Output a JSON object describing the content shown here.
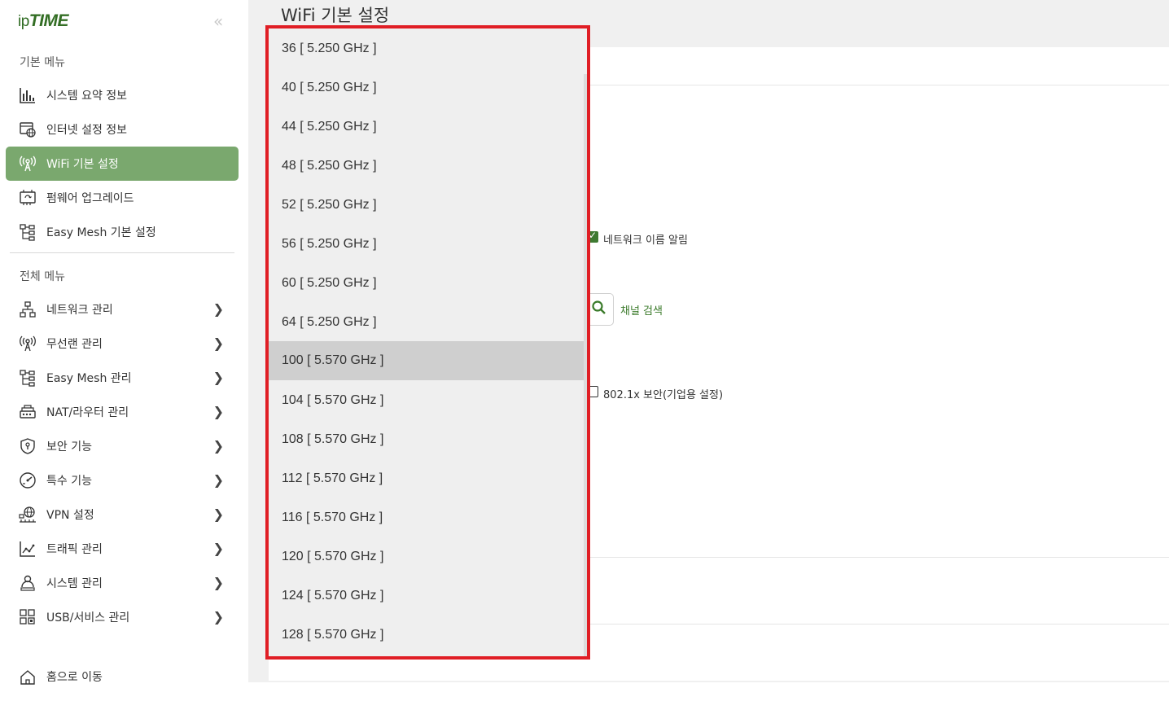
{
  "sidebar": {
    "logo_ip": "ip",
    "logo_time": "TIME",
    "collapse_glyph": "«",
    "basic_section": "기본 메뉴",
    "basic_items": [
      {
        "label": "시스템 요약 정보",
        "icon": "bar-chart-icon"
      },
      {
        "label": "인터넷 설정 정보",
        "icon": "internet-settings-icon"
      },
      {
        "label": "WiFi 기본 설정",
        "icon": "wifi-antenna-icon",
        "active": true
      },
      {
        "label": "펌웨어 업그레이드",
        "icon": "firmware-chip-icon"
      },
      {
        "label": "Easy Mesh 기본 설정",
        "icon": "mesh-tree-icon"
      }
    ],
    "all_section": "전체 메뉴",
    "all_items": [
      {
        "label": "네트워크 관리",
        "icon": "network-icon"
      },
      {
        "label": "무선랜 관리",
        "icon": "wireless-icon"
      },
      {
        "label": "Easy Mesh 관리",
        "icon": "mesh-tree-icon"
      },
      {
        "label": "NAT/라우터 관리",
        "icon": "router-icon"
      },
      {
        "label": "보안 기능",
        "icon": "shield-icon"
      },
      {
        "label": "특수 기능",
        "icon": "gauge-icon"
      },
      {
        "label": "VPN 설정",
        "icon": "vpn-globe-icon"
      },
      {
        "label": "트래픽 관리",
        "icon": "traffic-chart-icon"
      },
      {
        "label": "시스템 관리",
        "icon": "admin-user-icon"
      },
      {
        "label": "USB/서비스 관리",
        "icon": "usb-grid-icon"
      }
    ],
    "home_label": "홈으로 이동"
  },
  "main": {
    "page_title": "WiFi 기본 설정",
    "network_name_notify": "네트워크 이름 알림",
    "channel_scan": "채널 검색",
    "security_8021x": "802.1x 보안(기업용 설정)"
  },
  "channel_dropdown": {
    "selected_index": 8,
    "options": [
      "36 [ 5.250 GHz ]",
      "40 [ 5.250 GHz ]",
      "44 [ 5.250 GHz ]",
      "48 [ 5.250 GHz ]",
      "52 [ 5.250 GHz ]",
      "56 [ 5.250 GHz ]",
      "60 [ 5.250 GHz ]",
      "64 [ 5.250 GHz ]",
      "100 [ 5.570 GHz ]",
      "104 [ 5.570 GHz ]",
      "108 [ 5.570 GHz ]",
      "112 [ 5.570 GHz ]",
      "116 [ 5.570 GHz ]",
      "120 [ 5.570 GHz ]",
      "124 [ 5.570 GHz ]",
      "128 [ 5.570 GHz ]"
    ]
  },
  "colors": {
    "accent_green": "#7aa86e",
    "highlight_red": "#e01e25"
  }
}
